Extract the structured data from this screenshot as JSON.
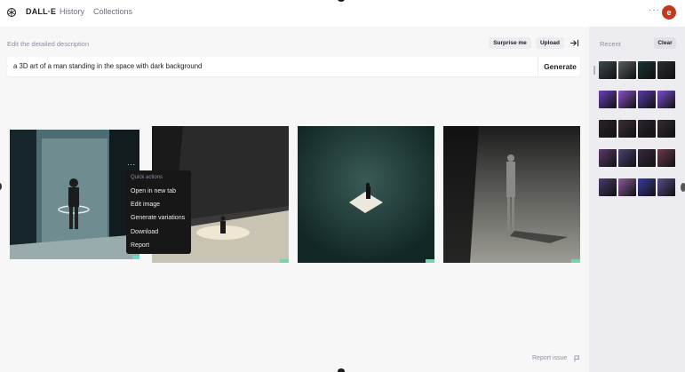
{
  "nav": {
    "brand": "DALL·E",
    "history": "History",
    "collections": "Collections",
    "more": "···",
    "avatar_initial": "e"
  },
  "editor": {
    "description_label": "Edit the detailed description",
    "surprise_label": "Surprise me",
    "upload_label": "Upload",
    "prompt_value": "a 3D art of a man standing in the space with dark background",
    "generate_label": "Generate"
  },
  "quick_actions": {
    "title": "Quick actions",
    "items": [
      "Open in new tab",
      "Edit image",
      "Generate variations",
      "Download",
      "Report"
    ]
  },
  "card_more": "···",
  "footer": {
    "report_issue": "Report issue"
  },
  "sidebar": {
    "recent_label": "Recent",
    "clear_label": "Clear",
    "thumb_rows": [
      [
        "#3a4a4e",
        "#5a5e60",
        "#1c3436",
        "#2a2c2e"
      ],
      [
        "#6a3fb8",
        "#8a52c8",
        "#5a3aa8",
        "#7a4ed0"
      ],
      [
        "#2a2428",
        "#3a2e34",
        "#2c2630",
        "#352a30"
      ],
      [
        "#5a3a6a",
        "#4a4270",
        "#3a2a40",
        "#6a3a4a"
      ],
      [
        "#4a3a6a",
        "#8a5a9a",
        "#3a3aa0",
        "#5a4a8a"
      ]
    ]
  },
  "colors": {
    "accent_avatar": "#c4391d",
    "menu_bg": "#171717"
  }
}
